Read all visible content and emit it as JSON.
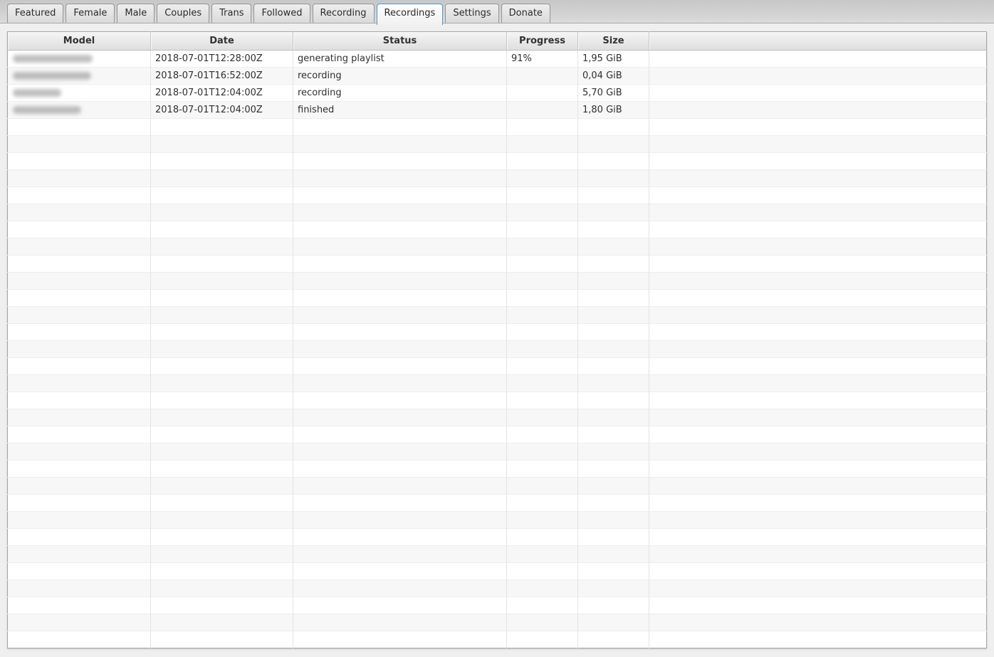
{
  "tabs": [
    {
      "label": "Featured",
      "selected": false
    },
    {
      "label": "Female",
      "selected": false
    },
    {
      "label": "Male",
      "selected": false
    },
    {
      "label": "Couples",
      "selected": false
    },
    {
      "label": "Trans",
      "selected": false
    },
    {
      "label": "Followed",
      "selected": false
    },
    {
      "label": "Recording",
      "selected": false
    },
    {
      "label": "Recordings",
      "selected": true
    },
    {
      "label": "Settings",
      "selected": false
    },
    {
      "label": "Donate",
      "selected": false
    }
  ],
  "table": {
    "columns": [
      "Model",
      "Date",
      "Status",
      "Progress",
      "Size",
      ""
    ],
    "rows": [
      {
        "model": "",
        "model_redacted": true,
        "date": "2018-07-01T12:28:00Z",
        "status": "generating playlist",
        "progress": "91%",
        "size": "1,95 GiB"
      },
      {
        "model": "",
        "model_redacted": true,
        "date": "2018-07-01T16:52:00Z",
        "status": "recording",
        "progress": "",
        "size": "0,04 GiB"
      },
      {
        "model": "",
        "model_redacted": true,
        "date": "2018-07-01T12:04:00Z",
        "status": "recording",
        "progress": "",
        "size": "5,70 GiB"
      },
      {
        "model": "",
        "model_redacted": true,
        "date": "2018-07-01T12:04:00Z",
        "status": "finished",
        "progress": "",
        "size": "1,80 GiB"
      }
    ],
    "empty_row_count": 31
  },
  "colors": {
    "selected_tab_border": "#4d97d4",
    "row_stripe": "#f7f7f7",
    "header_text": "#333333"
  }
}
